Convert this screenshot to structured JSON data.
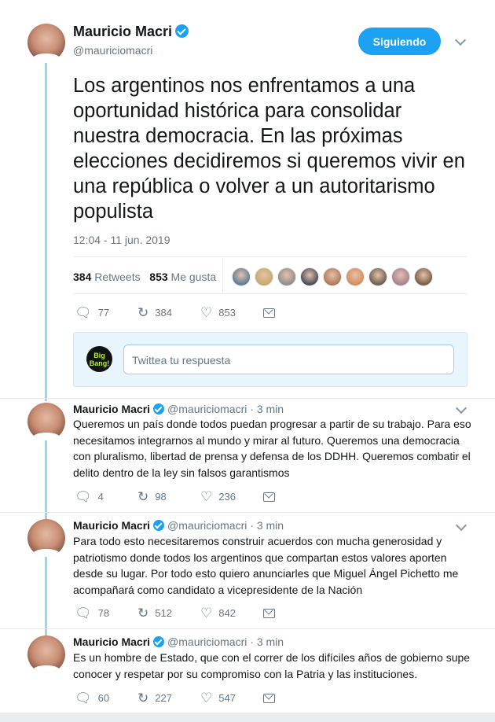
{
  "main_tweet": {
    "author_name": "Mauricio Macri",
    "handle": "@mauriciomacri",
    "follow_label": "Siguiendo",
    "text": "Los argentinos nos enfrentamos a una oportunidad histórica para consolidar nuestra democracia. En las próximas elecciones decidiremos si queremos vivir en una república o volver a un autoritarismo populista",
    "timestamp": "12:04 - 11 jun. 2019",
    "retweets_count": "384",
    "retweets_label": "Retweets",
    "likes_count": "853",
    "likes_label": "Me gusta",
    "liker_avatar_colors": [
      "#5b7c99",
      "#c9a86a",
      "#8e8e8e",
      "#4a4a5a",
      "#b0785a",
      "#d48c5c",
      "#6e5d4f",
      "#a67f93",
      "#7a5c46"
    ],
    "actions": {
      "replies": "77",
      "retweets": "384",
      "likes": "853"
    }
  },
  "reply_box": {
    "logo_text": "Big Bang!",
    "placeholder": "Twittea tu respuesta"
  },
  "replies": [
    {
      "author_name": "Mauricio Macri",
      "handle": "@mauriciomacri",
      "time": "· 3 min",
      "text": "Queremos un país donde todos puedan progresar a partir de su trabajo. Para eso necesitamos integrarnos al mundo y mirar al futuro. Queremos una democracia con pluralismo, libertad de prensa y defensa de los DDHH. Queremos combatir el delito dentro de la ley sin falsos garantismos",
      "replies": "4",
      "retweets": "98",
      "likes": "236"
    },
    {
      "author_name": "Mauricio Macri",
      "handle": "@mauriciomacri",
      "time": "· 3 min",
      "text": "Para todo esto necesitaremos construir acuerdos con mucha generosidad y patriotismo donde todos los argentinos que compartan estos valores aporten desde su lugar. Por todo esto quiero anunciarles que Miguel Ángel Pichetto me acompañará como candidato a vicepresidente de la Nación",
      "replies": "78",
      "retweets": "512",
      "likes": "842"
    },
    {
      "author_name": "Mauricio Macri",
      "handle": "@mauriciomacri",
      "time": "· 3 min",
      "text": "Es un hombre de Estado, que con el correr de los difíciles años de gobierno supe conocer y respetar por su compromiso con la Patria y las instituciones.",
      "replies": "60",
      "retweets": "227",
      "likes": "547"
    }
  ],
  "colors": {
    "accent": "#1da1f2",
    "thread_line": "#9cd4ec",
    "muted_text": "#657786"
  }
}
